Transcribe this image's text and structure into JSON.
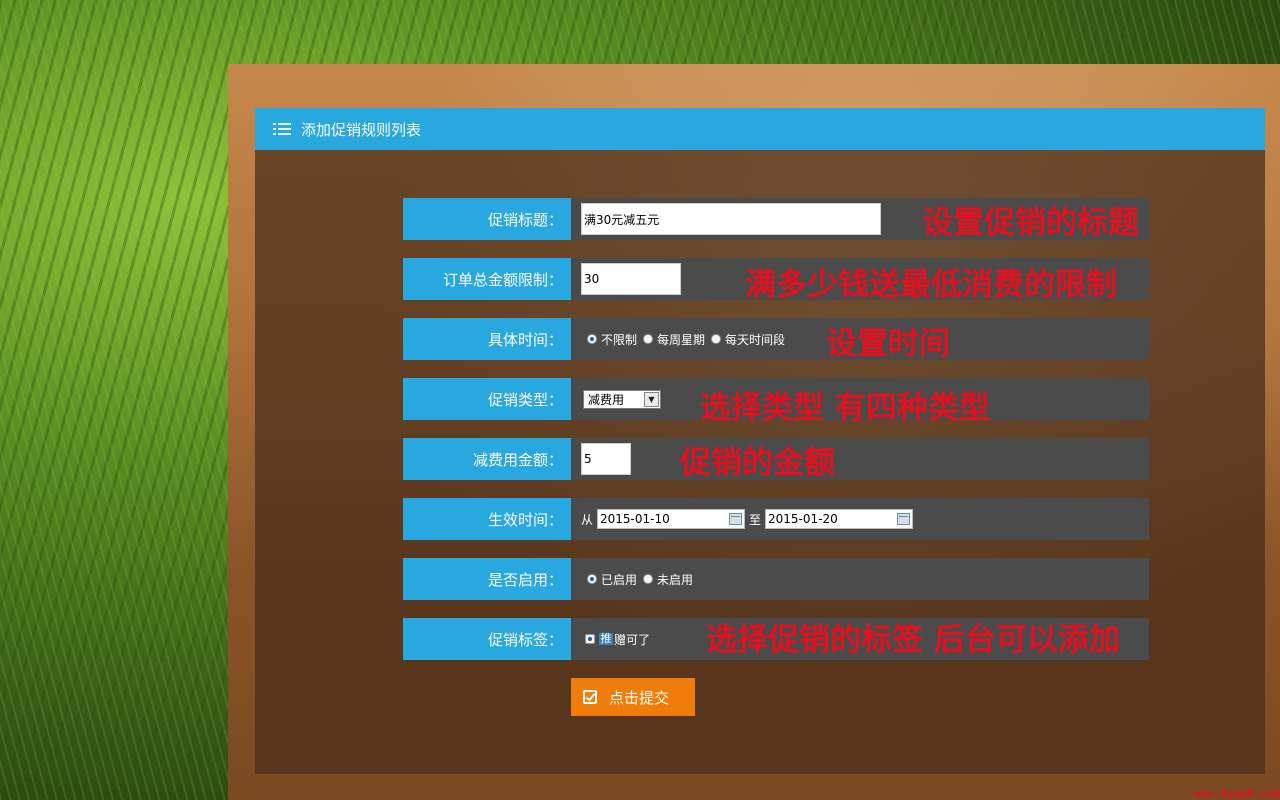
{
  "panel": {
    "title": "添加促销规则列表"
  },
  "form": {
    "title_label": "促销标题：",
    "title_value": "满30元减五元",
    "order_limit_label": "订单总金额限制：",
    "order_limit_value": "30",
    "time_label": "具体时间：",
    "time_options": [
      "不限制",
      "每周星期",
      "每天时间段"
    ],
    "type_label": "促销类型：",
    "type_selected": "减费用",
    "amount_label": "减费用金额：",
    "amount_value": "5",
    "effective_label": "生效时间：",
    "from_text": "从",
    "start_date": "2015-01-10",
    "to_text": "至",
    "end_date": "2015-01-20",
    "enabled_label": "是否启用：",
    "enabled_options": [
      "已启用",
      "未启用"
    ],
    "tag_label": "促销标签：",
    "tag_icon_text": "推",
    "tag_text": "赠可了",
    "submit_label": "点击提交"
  },
  "annotations": {
    "title": "设置促销的标题",
    "limit": "满多少钱送最低消费的限制",
    "time": "设置时间",
    "type": "选择类型 有四种类型",
    "amount": "促销的金额",
    "tag": "选择促销的标签 后台可以添加"
  },
  "watermark": "www.0yam0.com",
  "colors": {
    "header_blue": "#29a8e0",
    "row_gray": "#4b4b4b",
    "button_orange": "#f07c0a",
    "annotation_red": "#e3101e"
  }
}
